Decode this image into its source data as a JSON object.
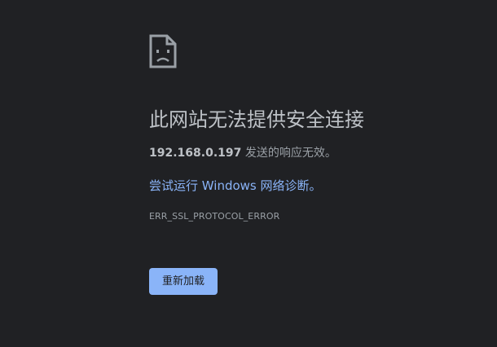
{
  "icon": "sad-page-icon",
  "headline": "此网站无法提供安全连接",
  "detail": {
    "host": "192.168.0.197",
    "message": " 发送的响应无效。"
  },
  "diagnostics_link": "尝试运行 Windows 网络诊断。",
  "error_code": "ERR_SSL_PROTOCOL_ERROR",
  "reload_button": "重新加载",
  "colors": {
    "background": "#202124",
    "text": "#bdc1c6",
    "muted": "#9aa0a6",
    "link": "#8ab4f8",
    "button": "#8ab4f8"
  }
}
